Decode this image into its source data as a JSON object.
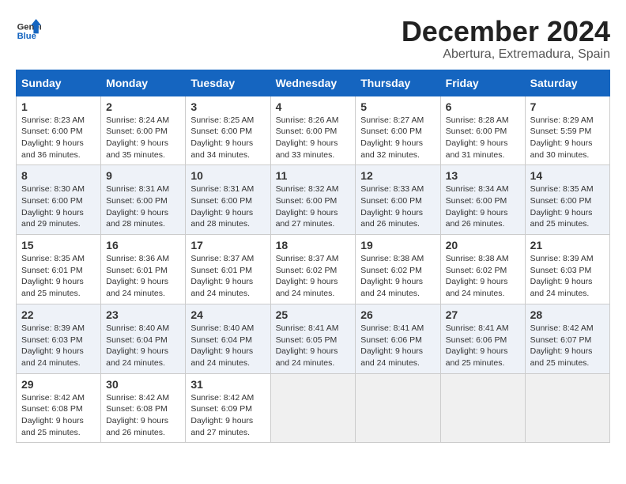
{
  "header": {
    "logo_general": "General",
    "logo_blue": "Blue",
    "month_title": "December 2024",
    "location": "Abertura, Extremadura, Spain"
  },
  "calendar": {
    "days_of_week": [
      "Sunday",
      "Monday",
      "Tuesday",
      "Wednesday",
      "Thursday",
      "Friday",
      "Saturday"
    ],
    "weeks": [
      [
        null,
        {
          "day": "2",
          "sunrise": "Sunrise: 8:24 AM",
          "sunset": "Sunset: 6:00 PM",
          "daylight": "Daylight: 9 hours and 35 minutes."
        },
        {
          "day": "3",
          "sunrise": "Sunrise: 8:25 AM",
          "sunset": "Sunset: 6:00 PM",
          "daylight": "Daylight: 9 hours and 34 minutes."
        },
        {
          "day": "4",
          "sunrise": "Sunrise: 8:26 AM",
          "sunset": "Sunset: 6:00 PM",
          "daylight": "Daylight: 9 hours and 33 minutes."
        },
        {
          "day": "5",
          "sunrise": "Sunrise: 8:27 AM",
          "sunset": "Sunset: 6:00 PM",
          "daylight": "Daylight: 9 hours and 32 minutes."
        },
        {
          "day": "6",
          "sunrise": "Sunrise: 8:28 AM",
          "sunset": "Sunset: 6:00 PM",
          "daylight": "Daylight: 9 hours and 31 minutes."
        },
        {
          "day": "7",
          "sunrise": "Sunrise: 8:29 AM",
          "sunset": "Sunset: 5:59 PM",
          "daylight": "Daylight: 9 hours and 30 minutes."
        }
      ],
      [
        {
          "day": "1",
          "sunrise": "Sunrise: 8:23 AM",
          "sunset": "Sunset: 6:00 PM",
          "daylight": "Daylight: 9 hours and 36 minutes."
        },
        {
          "day": "9",
          "sunrise": "Sunrise: 8:31 AM",
          "sunset": "Sunset: 6:00 PM",
          "daylight": "Daylight: 9 hours and 28 minutes."
        },
        {
          "day": "10",
          "sunrise": "Sunrise: 8:31 AM",
          "sunset": "Sunset: 6:00 PM",
          "daylight": "Daylight: 9 hours and 28 minutes."
        },
        {
          "day": "11",
          "sunrise": "Sunrise: 8:32 AM",
          "sunset": "Sunset: 6:00 PM",
          "daylight": "Daylight: 9 hours and 27 minutes."
        },
        {
          "day": "12",
          "sunrise": "Sunrise: 8:33 AM",
          "sunset": "Sunset: 6:00 PM",
          "daylight": "Daylight: 9 hours and 26 minutes."
        },
        {
          "day": "13",
          "sunrise": "Sunrise: 8:34 AM",
          "sunset": "Sunset: 6:00 PM",
          "daylight": "Daylight: 9 hours and 26 minutes."
        },
        {
          "day": "14",
          "sunrise": "Sunrise: 8:35 AM",
          "sunset": "Sunset: 6:00 PM",
          "daylight": "Daylight: 9 hours and 25 minutes."
        }
      ],
      [
        {
          "day": "8",
          "sunrise": "Sunrise: 8:30 AM",
          "sunset": "Sunset: 6:00 PM",
          "daylight": "Daylight: 9 hours and 29 minutes."
        },
        {
          "day": "16",
          "sunrise": "Sunrise: 8:36 AM",
          "sunset": "Sunset: 6:01 PM",
          "daylight": "Daylight: 9 hours and 24 minutes."
        },
        {
          "day": "17",
          "sunrise": "Sunrise: 8:37 AM",
          "sunset": "Sunset: 6:01 PM",
          "daylight": "Daylight: 9 hours and 24 minutes."
        },
        {
          "day": "18",
          "sunrise": "Sunrise: 8:37 AM",
          "sunset": "Sunset: 6:02 PM",
          "daylight": "Daylight: 9 hours and 24 minutes."
        },
        {
          "day": "19",
          "sunrise": "Sunrise: 8:38 AM",
          "sunset": "Sunset: 6:02 PM",
          "daylight": "Daylight: 9 hours and 24 minutes."
        },
        {
          "day": "20",
          "sunrise": "Sunrise: 8:38 AM",
          "sunset": "Sunset: 6:02 PM",
          "daylight": "Daylight: 9 hours and 24 minutes."
        },
        {
          "day": "21",
          "sunrise": "Sunrise: 8:39 AM",
          "sunset": "Sunset: 6:03 PM",
          "daylight": "Daylight: 9 hours and 24 minutes."
        }
      ],
      [
        {
          "day": "15",
          "sunrise": "Sunrise: 8:35 AM",
          "sunset": "Sunset: 6:01 PM",
          "daylight": "Daylight: 9 hours and 25 minutes."
        },
        {
          "day": "23",
          "sunrise": "Sunrise: 8:40 AM",
          "sunset": "Sunset: 6:04 PM",
          "daylight": "Daylight: 9 hours and 24 minutes."
        },
        {
          "day": "24",
          "sunrise": "Sunrise: 8:40 AM",
          "sunset": "Sunset: 6:04 PM",
          "daylight": "Daylight: 9 hours and 24 minutes."
        },
        {
          "day": "25",
          "sunrise": "Sunrise: 8:41 AM",
          "sunset": "Sunset: 6:05 PM",
          "daylight": "Daylight: 9 hours and 24 minutes."
        },
        {
          "day": "26",
          "sunrise": "Sunrise: 8:41 AM",
          "sunset": "Sunset: 6:06 PM",
          "daylight": "Daylight: 9 hours and 24 minutes."
        },
        {
          "day": "27",
          "sunrise": "Sunrise: 8:41 AM",
          "sunset": "Sunset: 6:06 PM",
          "daylight": "Daylight: 9 hours and 25 minutes."
        },
        {
          "day": "28",
          "sunrise": "Sunrise: 8:42 AM",
          "sunset": "Sunset: 6:07 PM",
          "daylight": "Daylight: 9 hours and 25 minutes."
        }
      ],
      [
        {
          "day": "22",
          "sunrise": "Sunrise: 8:39 AM",
          "sunset": "Sunset: 6:03 PM",
          "daylight": "Daylight: 9 hours and 24 minutes."
        },
        {
          "day": "30",
          "sunrise": "Sunrise: 8:42 AM",
          "sunset": "Sunset: 6:08 PM",
          "daylight": "Daylight: 9 hours and 26 minutes."
        },
        {
          "day": "31",
          "sunrise": "Sunrise: 8:42 AM",
          "sunset": "Sunset: 6:09 PM",
          "daylight": "Daylight: 9 hours and 27 minutes."
        },
        null,
        null,
        null,
        null
      ],
      [
        {
          "day": "29",
          "sunrise": "Sunrise: 8:42 AM",
          "sunset": "Sunset: 6:08 PM",
          "daylight": "Daylight: 9 hours and 25 minutes."
        },
        null,
        null,
        null,
        null,
        null,
        null
      ]
    ]
  }
}
